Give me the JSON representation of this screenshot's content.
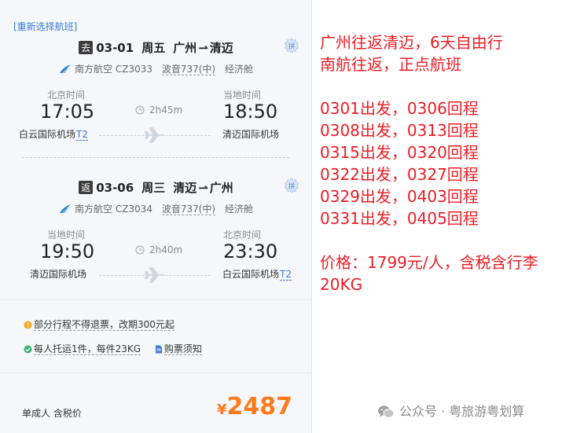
{
  "left_panel": {
    "reselect_link": "[重新选择航班]",
    "outbound": {
      "tag": "去",
      "date": "03-01",
      "weekday": "周五",
      "from_city": "广州",
      "to_city": "清迈",
      "arrow": "⇀",
      "airline": "南方航空",
      "flight_no": "CZ3033",
      "aircraft": "波音737(中)",
      "cabin": "经济舱",
      "dep_tz": "北京时间",
      "dep_time": "17:05",
      "dep_airport": "白云国际机场",
      "dep_terminal": "T2",
      "duration": "2h45m",
      "arr_tz": "当地时间",
      "arr_time": "18:50",
      "arr_airport": "清迈国际机场",
      "arr_terminal": ""
    },
    "return": {
      "tag": "返",
      "date": "03-06",
      "weekday": "周三",
      "from_city": "清迈",
      "to_city": "广州",
      "arrow": "⇀",
      "airline": "南方航空",
      "flight_no": "CZ3034",
      "aircraft": "波音737(中)",
      "cabin": "经济舱",
      "dep_tz": "当地时间",
      "dep_time": "19:50",
      "dep_airport": "清迈国际机场",
      "dep_terminal": "",
      "duration": "2h40m",
      "arr_tz": "北京时间",
      "arr_time": "23:30",
      "arr_airport": "白云国际机场",
      "arr_terminal": "T2"
    },
    "badge_text": "拼",
    "notes": {
      "refund": "部分行程不得退票，改期300元起",
      "baggage": "每人托运1件，每件23KG",
      "ticket_notice": "购票须知"
    },
    "price_label": "单成人 含税价",
    "price_currency": "¥",
    "price_amount": "2487"
  },
  "promo": {
    "line1": "广州往返清迈，6天自由行",
    "line2": "南航往返，正点航班",
    "schedules": [
      "0301出发，0306回程",
      "0308出发，0313回程",
      "0315出发，0320回程",
      "0322出发，0327回程",
      "0329出发，0403回程",
      "0331出发，0405回程"
    ],
    "price_line1": "价格：1799元/人，含税含行李",
    "price_line2": "20KG"
  },
  "footer": {
    "text": "公众号 · 粤旅游粤划算"
  },
  "colors": {
    "promo_red": "#ee1c25",
    "price_orange": "#ff7a1a",
    "link_blue": "#3a7bd5",
    "card_bg": "#f5f7fa"
  }
}
